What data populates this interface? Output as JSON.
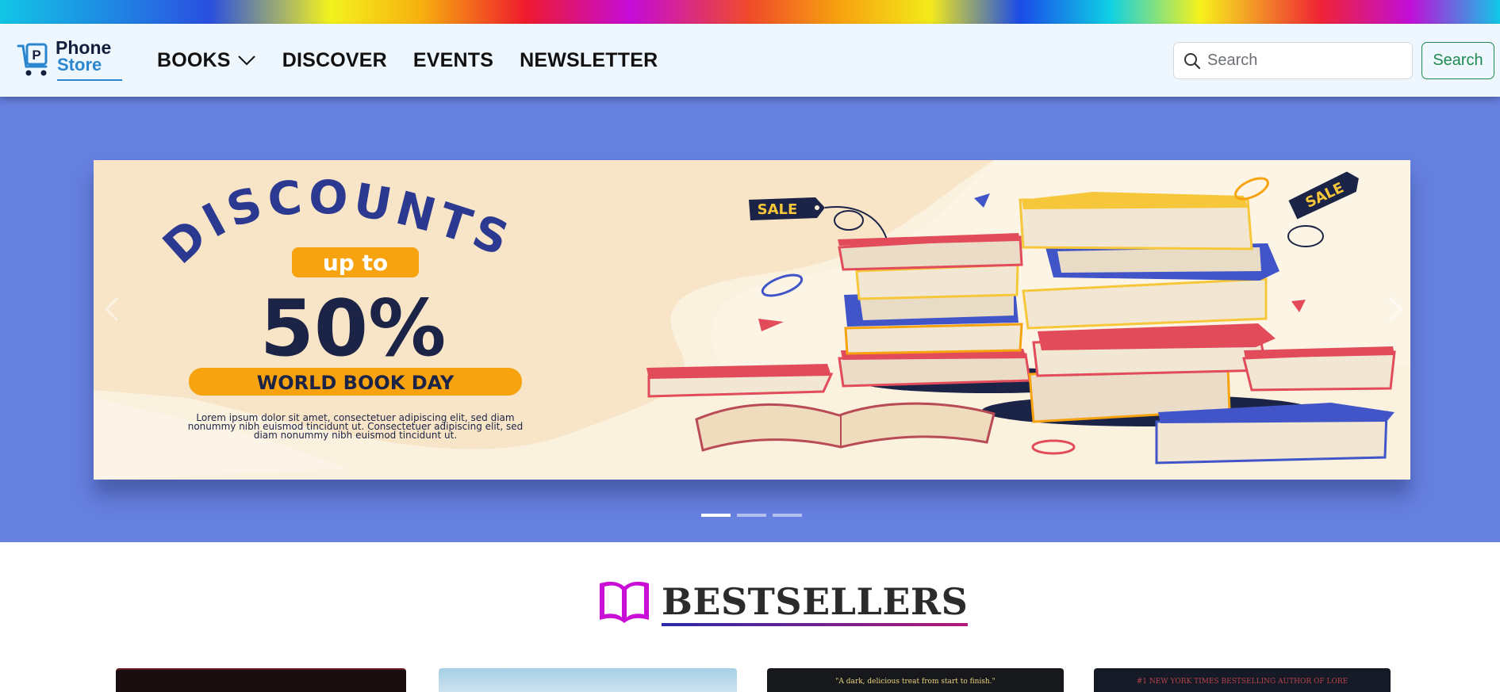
{
  "logo": {
    "line1": "Phone",
    "line2": "Store",
    "badge_letter": "P"
  },
  "nav": {
    "items": [
      {
        "label": "BOOKS",
        "has_dropdown": true
      },
      {
        "label": "DISCOVER"
      },
      {
        "label": "EVENTS"
      },
      {
        "label": "NEWSLETTER"
      }
    ]
  },
  "search": {
    "placeholder": "Search",
    "value": "",
    "button_label": "Search"
  },
  "carousel": {
    "active_index": 0,
    "slide_count": 3,
    "slide": {
      "headline": "DISCOUNTS",
      "pill": "up to",
      "percent": "50%",
      "banner": "WORLD BOOK DAY",
      "body_line1": "Lorem ipsum dolor sit amet, consectetuer adipiscing elit, sed diam",
      "body_line2": "nonummy nibh euismod tincidunt ut. Consectetuer adipiscing elit, sed",
      "body_line3": "diam nonummy nibh euismod tincidunt ut.",
      "tag1": "SALE",
      "tag2": "SALE"
    }
  },
  "bestsellers": {
    "title": "BESTSELLERS",
    "book_snippets": [
      "\"A dark, delicious treat from start to finish.\"",
      "#1 NEW YORK TIMES BESTSELLING AUTHOR OF LORE"
    ]
  },
  "colors": {
    "navbar_bg": "#eef6fe",
    "hero_bg": "#6680e0",
    "accent_green": "#1e8a4f",
    "brand_blue": "#2a86cf",
    "bestsellers_icon": "#c90fd6"
  },
  "icons": [
    "chevron-down-icon",
    "search-icon",
    "chevron-left-icon",
    "chevron-right-icon",
    "open-book-icon"
  ]
}
